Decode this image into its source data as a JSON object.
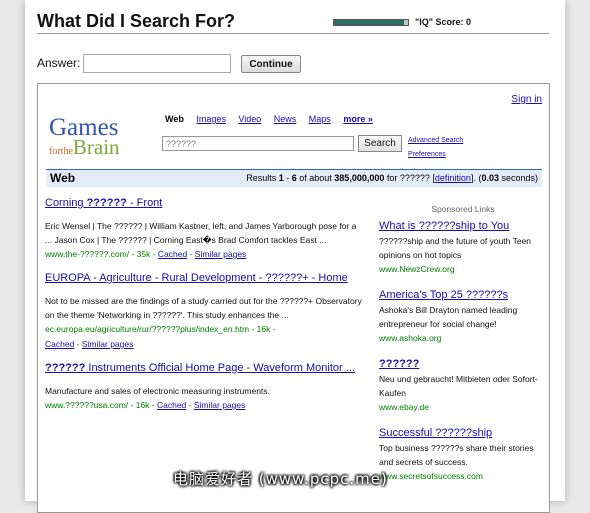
{
  "header": {
    "title": "What Did I Search For?",
    "iq_label": "\"IQ\" Score: 0",
    "iq_progress": 0.95,
    "accent_color": "#2c6e61"
  },
  "answer": {
    "label": "Answer:",
    "value": "",
    "button": "Continue"
  },
  "serp": {
    "signin": "Sign in",
    "logo": {
      "games": "Games",
      "forthe": "forthe",
      "brain": "Brain"
    },
    "tabs": [
      {
        "label": "Web"
      },
      {
        "label": "Images"
      },
      {
        "label": "Video"
      },
      {
        "label": "News"
      },
      {
        "label": "Maps"
      },
      {
        "label": "more »"
      }
    ],
    "search_value": "??????",
    "search_button": "Search",
    "advanced_search": "Advanced Search",
    "preferences": "Preferences",
    "bar": {
      "label": "Web",
      "stats_prefix": "Results ",
      "range_start": "1",
      "range_sep": " - ",
      "range_end": "6",
      "of_about": " of about ",
      "total": "385,000,000",
      "for": " for ?????? [",
      "definition": "definition",
      "close": "]. (",
      "time": "0.03",
      "seconds": " seconds)"
    },
    "results": [
      {
        "title_a": "Corning ",
        "title_b": "??????",
        "title_c": " - Front",
        "snippet": "Eric Wensel | The ?????? | William Kastner, left, and James Yarborough pose for a ... Jason Cox | The ?????? | Corning East�s Brad Comfort tackles East ...",
        "url": "www.the-??????.com/ - 35k - ",
        "cached": "Cached",
        "dash": " - ",
        "similar": "Similar pages"
      },
      {
        "title_a": "EUROPA - Agriculture - Rural Development - ??????+ - Home",
        "title_b": "",
        "title_c": "",
        "snippet": "Not to be missed are the findings of a study carried out for the ??????+ Observatory on the theme 'Networking in ??????'. This study enhances the ...",
        "url": "ec.europa.eu/agriculture/rur/??????plus/index_en.htm - 16k - ",
        "cached": "Cached",
        "dash": " - ",
        "similar": "Similar pages"
      },
      {
        "title_a": "",
        "title_b": "??????",
        "title_c": " Instruments Official Home Page - Waveform Monitor ...",
        "snippet": "Manufacture and sales of electronic measuring instruments.",
        "url": "www.??????usa.com/ - 16k - ",
        "cached": "Cached",
        "dash": " - ",
        "similar": "Similar pages"
      }
    ],
    "sponsored_label": "Sponsored Links",
    "ads": [
      {
        "title": "What is ??????ship to You",
        "text": "??????ship and the future of youth Teen opinions on hot topics",
        "url": "www.NewzCrew.org"
      },
      {
        "title": "America's Top 25 ??????s",
        "text": "Ashoka's Bill Drayton named leading entrepreneur for social change!",
        "url": "www.ashoka.org"
      },
      {
        "title": "??????",
        "text": "Neu und gebraucht! Mitbieten oder Sofort-Kaufen",
        "url": "www.ebay.de"
      },
      {
        "title": "Successful ??????ship",
        "text": "Top business ??????s share their stories and secrets of success.",
        "url": "www.secretsofsuccess.com"
      }
    ]
  },
  "watermark": "电脑爱好者 (www.pcpc.me)"
}
